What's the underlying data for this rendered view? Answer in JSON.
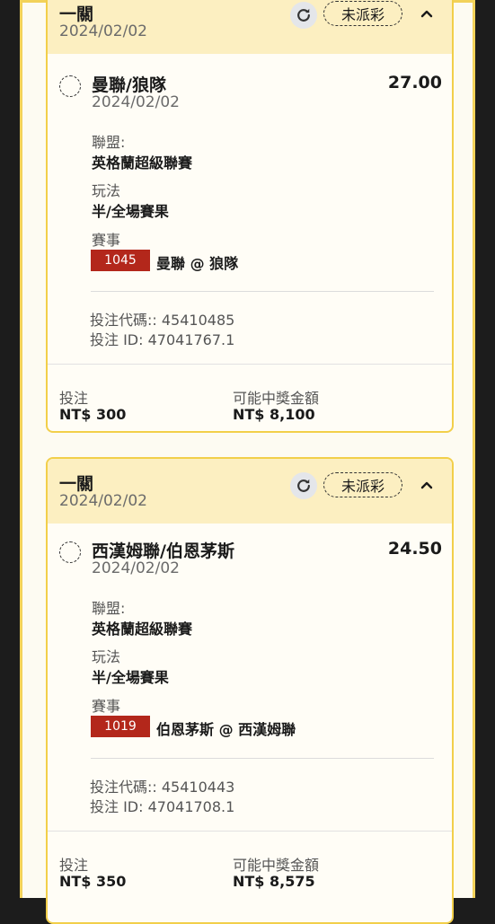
{
  "bets": [
    {
      "type": "一關",
      "date": "2024/02/02",
      "status": "未派彩",
      "selection": {
        "name": "曼聯/狼隊",
        "date": "2024/02/02",
        "odds": "27.00",
        "league_label": "聯盟:",
        "league": "英格蘭超級聯賽",
        "market_label": "玩法",
        "market": "半/全場賽果",
        "event_label": "賽事",
        "event_id": "1045",
        "event_name": "曼聯 @ 狼隊"
      },
      "bet_code": "投注代碼:: 45410485",
      "bet_id": "投注 ID: 47041767.1",
      "stake_label": "投注",
      "stake": "NT$ 300",
      "payout_label": "可能中獎金額",
      "payout": "NT$ 8,100"
    },
    {
      "type": "一關",
      "date": "2024/02/02",
      "status": "未派彩",
      "selection": {
        "name": "西漢姆聯/伯恩茅斯",
        "date": "2024/02/02",
        "odds": "24.50",
        "league_label": "聯盟:",
        "league": "英格蘭超級聯賽",
        "market_label": "玩法",
        "market": "半/全場賽果",
        "event_label": "賽事",
        "event_id": "1019",
        "event_name": "伯恩茅斯 @ 西漢姆聯"
      },
      "bet_code": "投注代碼:: 45410443",
      "bet_id": "投注 ID: 47041708.1",
      "stake_label": "投注",
      "stake": "NT$ 350",
      "payout_label": "可能中獎金額",
      "payout": "NT$ 8,575"
    }
  ],
  "icons": {
    "refresh": "refresh-icon",
    "collapse": "chevron-up-icon"
  },
  "colors": {
    "accent_border": "#f2cf4a",
    "header_bg": "#fcefc1",
    "event_badge": "#b3271b"
  }
}
